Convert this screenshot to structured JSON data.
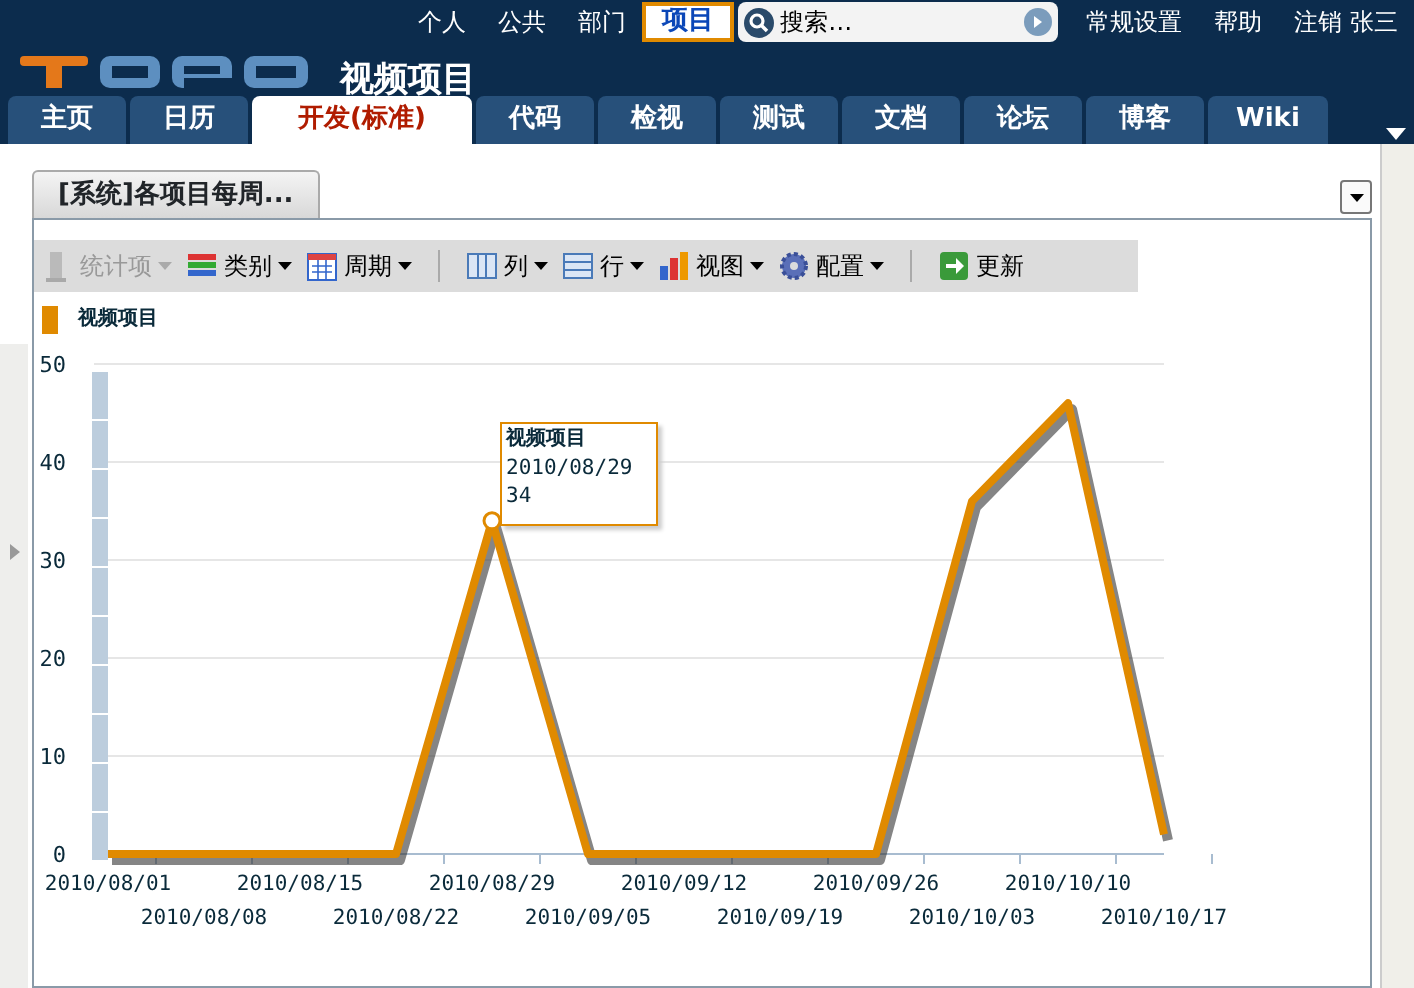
{
  "top_links": [
    {
      "label": "个人",
      "selected": false
    },
    {
      "label": "公共",
      "selected": false
    },
    {
      "label": "部门",
      "selected": false
    },
    {
      "label": "项目",
      "selected": true
    }
  ],
  "search": {
    "placeholder": "搜索…"
  },
  "user_links": [
    "常规设置",
    "帮助",
    "注销 张三"
  ],
  "project_title": "视频项目",
  "tabs": [
    {
      "label": "主页",
      "selected": false
    },
    {
      "label": "日历",
      "selected": false
    },
    {
      "label": "开发(标准)",
      "selected": true
    },
    {
      "label": "代码",
      "selected": false
    },
    {
      "label": "检视",
      "selected": false
    },
    {
      "label": "测试",
      "selected": false
    },
    {
      "label": "文档",
      "selected": false
    },
    {
      "label": "论坛",
      "selected": false
    },
    {
      "label": "博客",
      "selected": false
    },
    {
      "label": "Wiki",
      "selected": false
    }
  ],
  "portlet": {
    "title": "[系统]各项目每周...",
    "toolbar": [
      {
        "label": "统计项",
        "disabled": true,
        "dropdown": true,
        "separator_before": false
      },
      {
        "label": "类别",
        "disabled": false,
        "dropdown": true,
        "separator_before": false
      },
      {
        "label": "周期",
        "disabled": false,
        "dropdown": true,
        "separator_before": false
      },
      {
        "label": "列",
        "disabled": false,
        "dropdown": true,
        "separator_before": true
      },
      {
        "label": "行",
        "disabled": false,
        "dropdown": true,
        "separator_before": false
      },
      {
        "label": "视图",
        "disabled": false,
        "dropdown": true,
        "separator_before": false
      },
      {
        "label": "配置",
        "disabled": false,
        "dropdown": true,
        "separator_before": false
      },
      {
        "label": "更新",
        "disabled": false,
        "dropdown": false,
        "separator_before": true
      }
    ],
    "chart_data": {
      "type": "line",
      "categories": [
        "2010/08/01",
        "2010/08/08",
        "2010/08/15",
        "2010/08/22",
        "2010/08/29",
        "2010/09/05",
        "2010/09/12",
        "2010/09/19",
        "2010/09/26",
        "2010/10/03",
        "2010/10/10",
        "2010/10/17"
      ],
      "series": [
        {
          "name": "视频项目",
          "color": "#e08a00",
          "values": [
            0,
            0,
            0,
            0,
            34,
            0,
            0,
            0,
            0,
            36,
            46,
            2
          ]
        }
      ],
      "grid": true,
      "ylim": [
        0,
        50
      ],
      "yticks": [
        0,
        10,
        20,
        30,
        40,
        50
      ]
    },
    "tooltip": {
      "title": "视频项目",
      "date": "2010/08/29",
      "value": "34"
    }
  }
}
